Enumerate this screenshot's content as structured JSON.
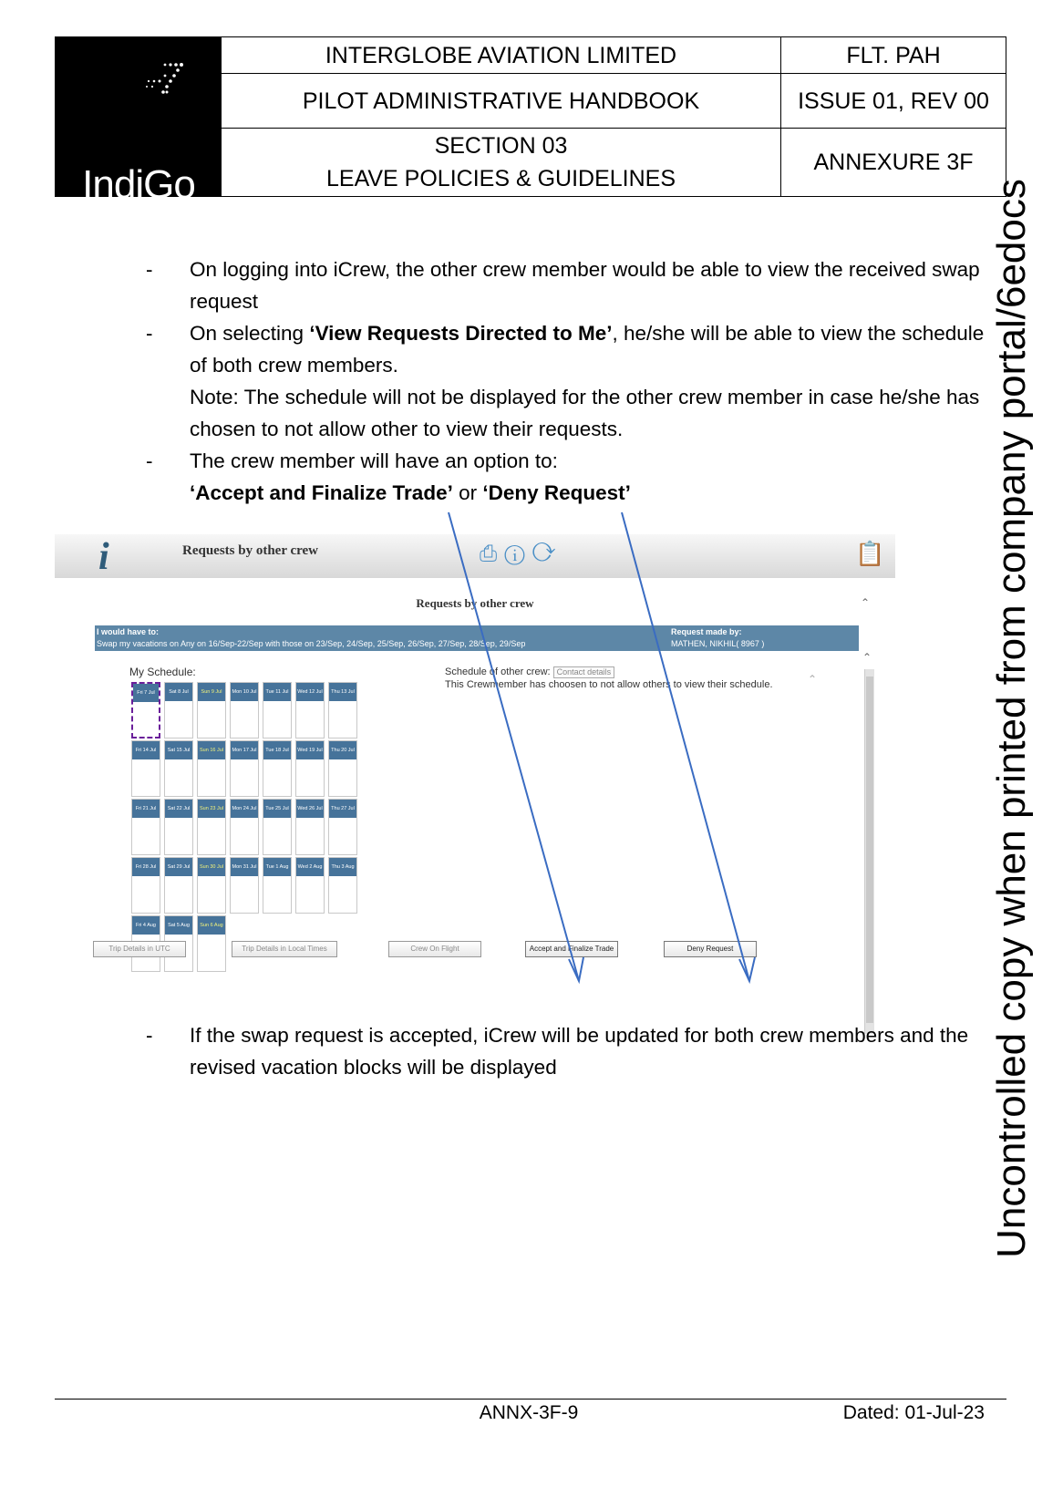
{
  "header": {
    "logo_text": "IndiGo",
    "company": "INTERGLOBE AVIATION LIMITED",
    "handbook": "PILOT ADMINISTRATIVE HANDBOOK",
    "section_line1": "SECTION 03",
    "section_line2": "LEAVE POLICIES & GUIDELINES",
    "doc_code": "FLT. PAH",
    "issue": "ISSUE 01, REV 00",
    "annexure": "ANNEXURE 3F"
  },
  "bullets": {
    "dash": "-",
    "b1": "On logging into iCrew, the other crew member would be able to view the received swap request",
    "b2_pre": "On selecting ",
    "b2_bold": "‘View Requests Directed to Me’",
    "b2_post": ", he/she will be able to view the schedule of both crew members.",
    "b2_note": "Note: The schedule will not be displayed for the other crew member in case he/she has chosen to not allow other to view their requests.",
    "b3": "The crew member will have an option to:",
    "b3_opt1": "‘Accept and Finalize Trade’",
    "b3_or": " or ",
    "b3_opt2": "‘Deny Request’",
    "b4": "If the swap request is accepted, iCrew will be updated for both crew members and the revised vacation blocks will be displayed"
  },
  "screenshot": {
    "app_logo": "i",
    "window_title": "Requests by other crew",
    "subtitle": "Requests by other crew",
    "bar_left_title": "I would have to:",
    "bar_left_text": "Swap my vacations on Any on 16/Sep-22/Sep with those on 23/Sep, 24/Sep, 25/Sep, 26/Sep, 27/Sep, 28/Sep, 29/Sep",
    "bar_right_title": "Request made by:",
    "bar_right_text": "MATHEN, NIKHIL( 8967 )",
    "my_schedule": "My Schedule:",
    "other_schedule_label": "Schedule of other crew:",
    "contact_details": "Contact details",
    "other_schedule_msg": "This Crewmember has choosen to not allow others to view their schedule.",
    "days": [
      [
        "Fri 7 Jul",
        "Sat 8 Jul",
        "Sun 9 Jul",
        "Mon 10 Jul",
        "Tue 11 Jul",
        "Wed 12 Jul",
        "Thu 13 Jul"
      ],
      [
        "Fri 14 Jul",
        "Sat 15 Jul",
        "Sun 16 Jul",
        "Mon 17 Jul",
        "Tue 18 Jul",
        "Wed 19 Jul",
        "Thu 20 Jul"
      ],
      [
        "Fri 21 Jul",
        "Sat 22 Jul",
        "Sun 23 Jul",
        "Mon 24 Jul",
        "Tue 25 Jul",
        "Wed 26 Jul",
        "Thu 27 Jul"
      ],
      [
        "Fri 28 Jul",
        "Sat 29 Jul",
        "Sun 30 Jul",
        "Mon 31 Jul",
        "Tue 1 Aug",
        "Wed 2 Aug",
        "Thu 3 Aug"
      ],
      [
        "Fri 4 Aug",
        "Sat 5 Aug",
        "Sun 6 Aug"
      ]
    ],
    "buttons": {
      "trip_utc": "Trip Details in UTC",
      "trip_local": "Trip Details in Local Times",
      "crew_on_flight": "Crew On Flight",
      "accept": "Accept and Finalize Trade",
      "deny": "Deny Request"
    },
    "icons": [
      "print-icon",
      "help-icon",
      "refresh-icon",
      "calendar-icon"
    ],
    "accent": "#46739a"
  },
  "watermark": "Uncontrolled copy when printed from company portal/6edocs",
  "footer": {
    "code": "ANNX-3F-9",
    "date": "Dated: 01-Jul-23"
  }
}
